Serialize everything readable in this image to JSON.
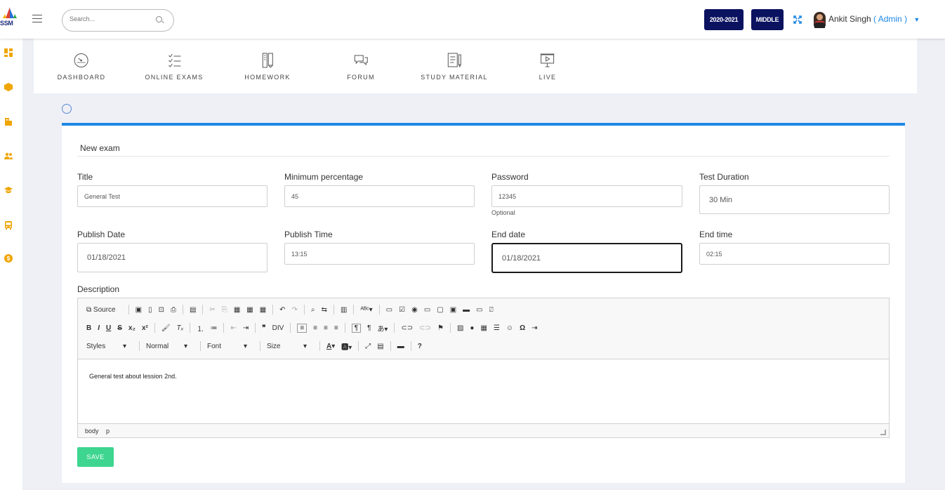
{
  "brand": {
    "logo_text": "SSM"
  },
  "header": {
    "search_placeholder": "Search...",
    "session_year": "2020-2021",
    "section": "MIDDLE",
    "user_name": "Ankit Singh",
    "user_role": "( Admin )"
  },
  "sidebar": {
    "icons": [
      "dashboard-icon",
      "cube-icon",
      "building-icon",
      "users-icon",
      "graduation-cap-icon",
      "bus-icon",
      "coin-icon"
    ]
  },
  "nav": {
    "items": [
      {
        "label": "DASHBOARD",
        "icon": "gauge-icon"
      },
      {
        "label": "ONLINE EXAMS",
        "icon": "checklist-icon"
      },
      {
        "label": "HOMEWORK",
        "icon": "pencil-book-icon"
      },
      {
        "label": "FORUM",
        "icon": "chat-bubbles-icon"
      },
      {
        "label": "STUDY MATERIAL",
        "icon": "document-pen-icon"
      },
      {
        "label": "LIVE",
        "icon": "presentation-screen-icon"
      }
    ]
  },
  "form": {
    "title": "New exam",
    "fields": {
      "title": {
        "label": "Title",
        "value": "General Test"
      },
      "min_percentage": {
        "label": "Minimum percentage",
        "value": "45"
      },
      "password": {
        "label": "Password",
        "value": "12345",
        "help": "Optional"
      },
      "duration": {
        "label": "Test Duration",
        "value": "30 Min"
      },
      "publish_date": {
        "label": "Publish Date",
        "value": "01/18/2021"
      },
      "publish_time": {
        "label": "Publish Time",
        "value": "13:15"
      },
      "end_date": {
        "label": "End date",
        "value": "01/18/2021"
      },
      "end_time": {
        "label": "End time",
        "value": "02:15"
      }
    },
    "description": {
      "label": "Description",
      "content": "General test about lession 2nd.",
      "source_label": "Source",
      "combos": {
        "styles": "Styles",
        "format": "Normal",
        "font": "Font",
        "size": "Size"
      },
      "path": {
        "body": "body",
        "p": "p"
      }
    },
    "save_label": "SAVE"
  }
}
